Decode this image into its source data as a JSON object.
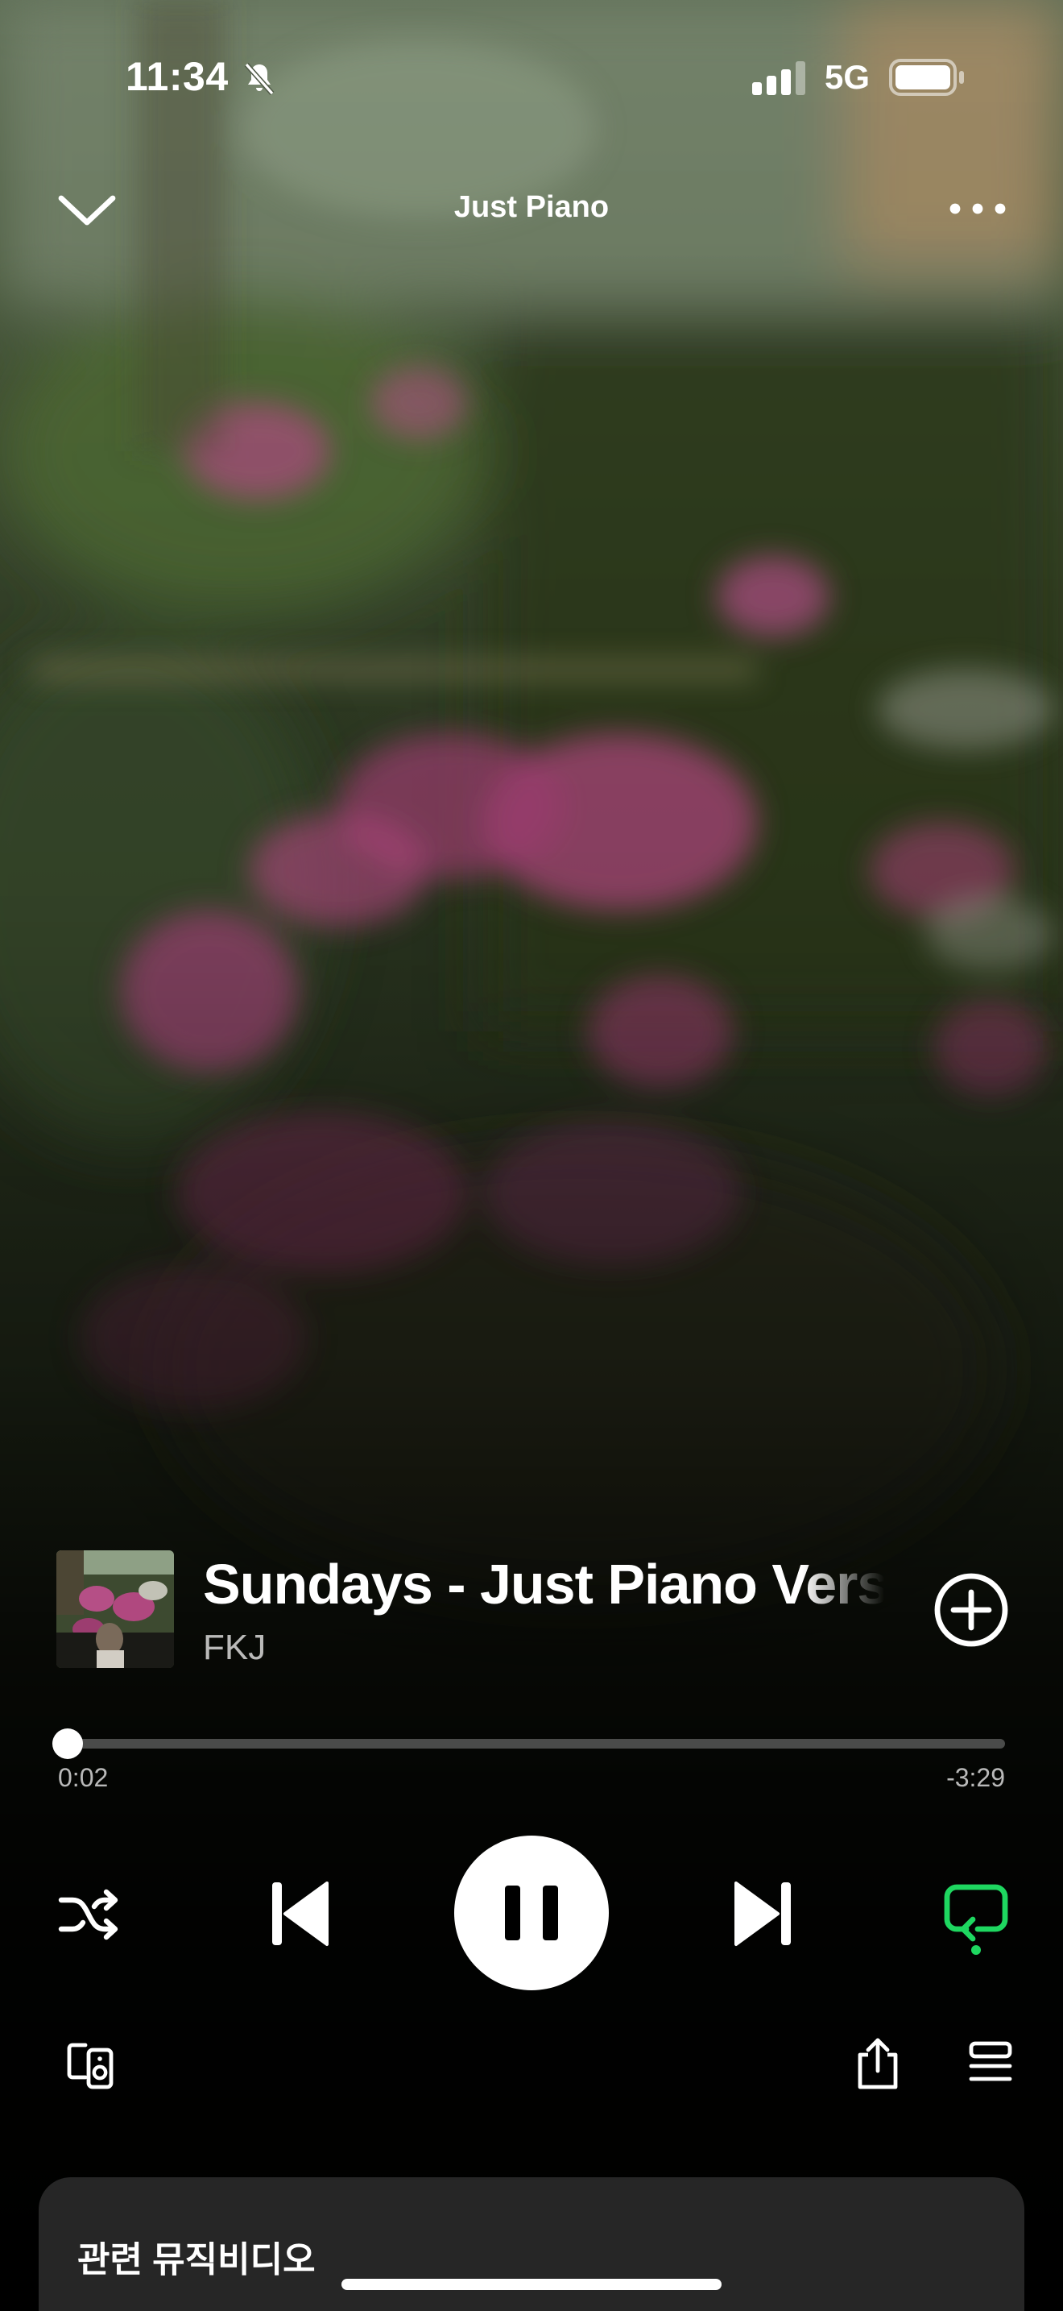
{
  "status_bar": {
    "time": "11:34",
    "network": "5G",
    "icons": [
      "bell-off-icon",
      "signal-icon",
      "battery-icon"
    ]
  },
  "header": {
    "playlist_title": "Just Piano",
    "left_icon": "chevron-down-icon",
    "right_icon": "more-dots-icon"
  },
  "track": {
    "title": "Sundays - Just Piano Version",
    "artist": "FKJ",
    "add_icon": "plus-circle-icon"
  },
  "progress": {
    "elapsed": "0:02",
    "remaining": "-3:29",
    "fraction": 0.01
  },
  "controls": {
    "shuffle_icon": "shuffle-icon",
    "previous_icon": "skip-previous-icon",
    "play_state_icon": "pause-icon",
    "next_icon": "skip-next-icon",
    "repeat_icon": "repeat-one-icon",
    "repeat_active": true
  },
  "actions": {
    "devices_icon": "connect-devices-icon",
    "share_icon": "share-icon",
    "queue_icon": "queue-icon"
  },
  "related": {
    "title": "관련 뮤직비디오"
  },
  "colors": {
    "accent": "#1ed760",
    "text_primary": "#ffffff",
    "card_background": "#262626"
  }
}
